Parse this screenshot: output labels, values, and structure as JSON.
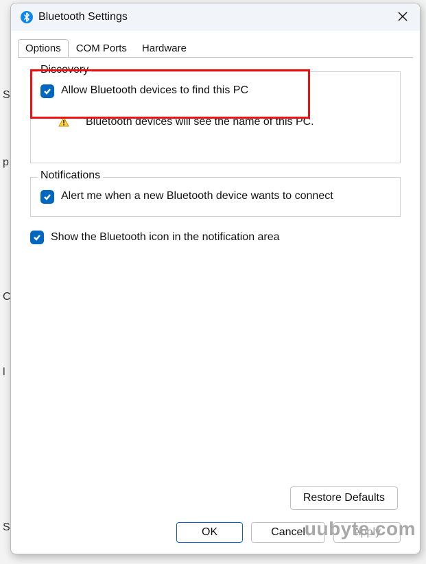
{
  "bg": {
    "s1": "S",
    "p": "p",
    "c": "C",
    "l": "l",
    "s2": "S"
  },
  "window": {
    "title": "Bluetooth Settings"
  },
  "tabs": {
    "options": "Options",
    "com_ports": "COM Ports",
    "hardware": "Hardware"
  },
  "discovery": {
    "legend": "Discovery",
    "checkbox_label": "Allow Bluetooth devices to find this PC",
    "info_text": "Bluetooth devices will see the name of this PC."
  },
  "notifications": {
    "legend": "Notifications",
    "checkbox_label": "Alert me when a new Bluetooth device wants to connect"
  },
  "show_icon": {
    "label": "Show the Bluetooth icon in the notification area"
  },
  "buttons": {
    "restore": "Restore Defaults",
    "ok": "OK",
    "cancel": "Cancel",
    "apply": "Apply"
  },
  "watermark": "uubyte.com"
}
